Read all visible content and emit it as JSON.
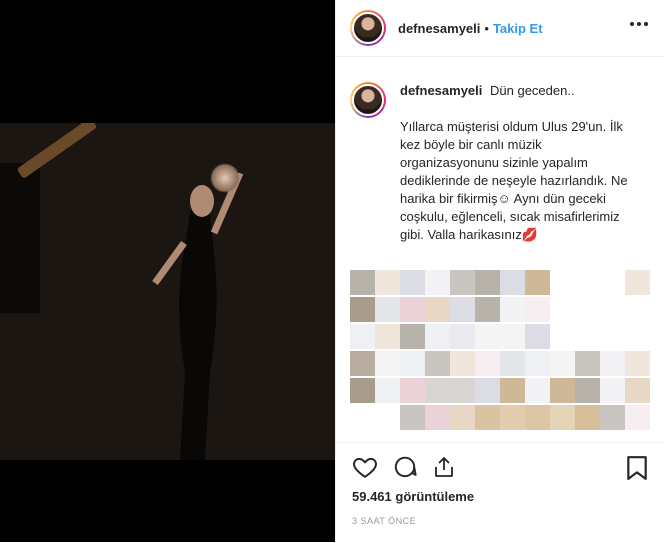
{
  "header": {
    "username": "defnesamyeli",
    "separator": "•",
    "follow_label": "Takip Et",
    "more_icon": "more-options-icon"
  },
  "caption": {
    "username": "defnesamyeli",
    "first_line": "Dün geceden..",
    "body": "Yıllarca müşterisi oldum Ulus 29'un. İlk kez böyle bir canlı müzik organizasyonunu sizinle yapalım dediklerinde de neşeyle hazırlandık. Ne harika bir fikirmiş☺ Aynı dün geceki coşkulu, eğlenceli, sıcak misafirlerimiz gibi. Valla harikasınız💋"
  },
  "actions": {
    "like_icon": "heart-icon",
    "comment_icon": "comment-icon",
    "share_icon": "share-icon",
    "save_icon": "bookmark-icon"
  },
  "stats": {
    "views": "59.461 görüntüleme",
    "time": "3 SAAT ÖNCE"
  },
  "colors": {
    "link": "#3897f0",
    "text": "#262626",
    "muted": "#999999",
    "border": "#efefef"
  }
}
